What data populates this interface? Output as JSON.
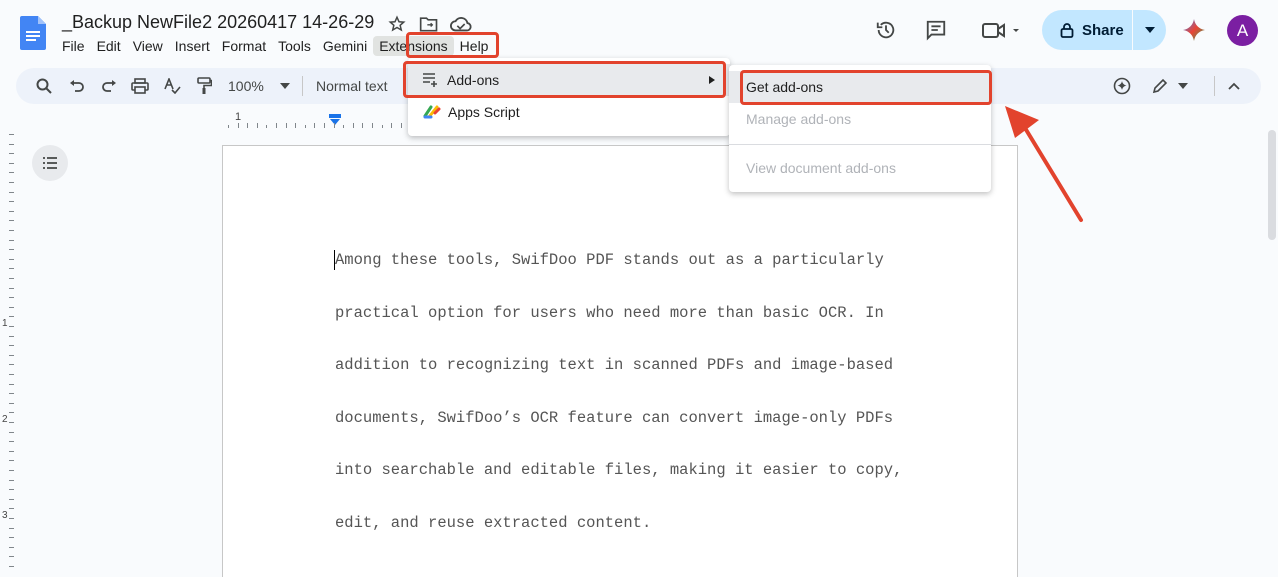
{
  "doc": {
    "title": "_Backup NewFile2 20260417 14-26-29"
  },
  "menubar": [
    "File",
    "Edit",
    "View",
    "Insert",
    "Format",
    "Tools",
    "Gemini",
    "Extensions",
    "Help"
  ],
  "header": {
    "share_label": "Share",
    "avatar_initial": "A",
    "accent_color": "#c2e7ff",
    "avatar_color": "#7b1fa2"
  },
  "toolbar": {
    "zoom": "100%",
    "style": "Normal text"
  },
  "ruler": {
    "h_label": "1",
    "v_labels": [
      "1",
      "2",
      "3"
    ]
  },
  "extensions_menu": {
    "items": [
      {
        "label": "Add-ons",
        "icon": "addons-icon",
        "has_submenu": true
      },
      {
        "label": "Apps Script",
        "icon": "apps-script-icon",
        "has_submenu": false
      }
    ]
  },
  "addons_submenu": {
    "items": [
      {
        "label": "Get add-ons",
        "enabled": true
      },
      {
        "label": "Manage add-ons",
        "enabled": false
      },
      {
        "label": "View document add-ons",
        "enabled": false
      }
    ]
  },
  "document": {
    "lines": [
      "Among these tools, SwifDoo PDF stands out as a particularly",
      "practical option for users who need more than basic OCR. In",
      "addition to recognizing text in scanned PDFs and image-based",
      "documents, SwifDoo’s OCR feature can convert image-only PDFs",
      "into searchable and editable files, making it easier to copy,",
      "edit, and reuse extracted content."
    ]
  },
  "annotation_color": "#e2432d"
}
